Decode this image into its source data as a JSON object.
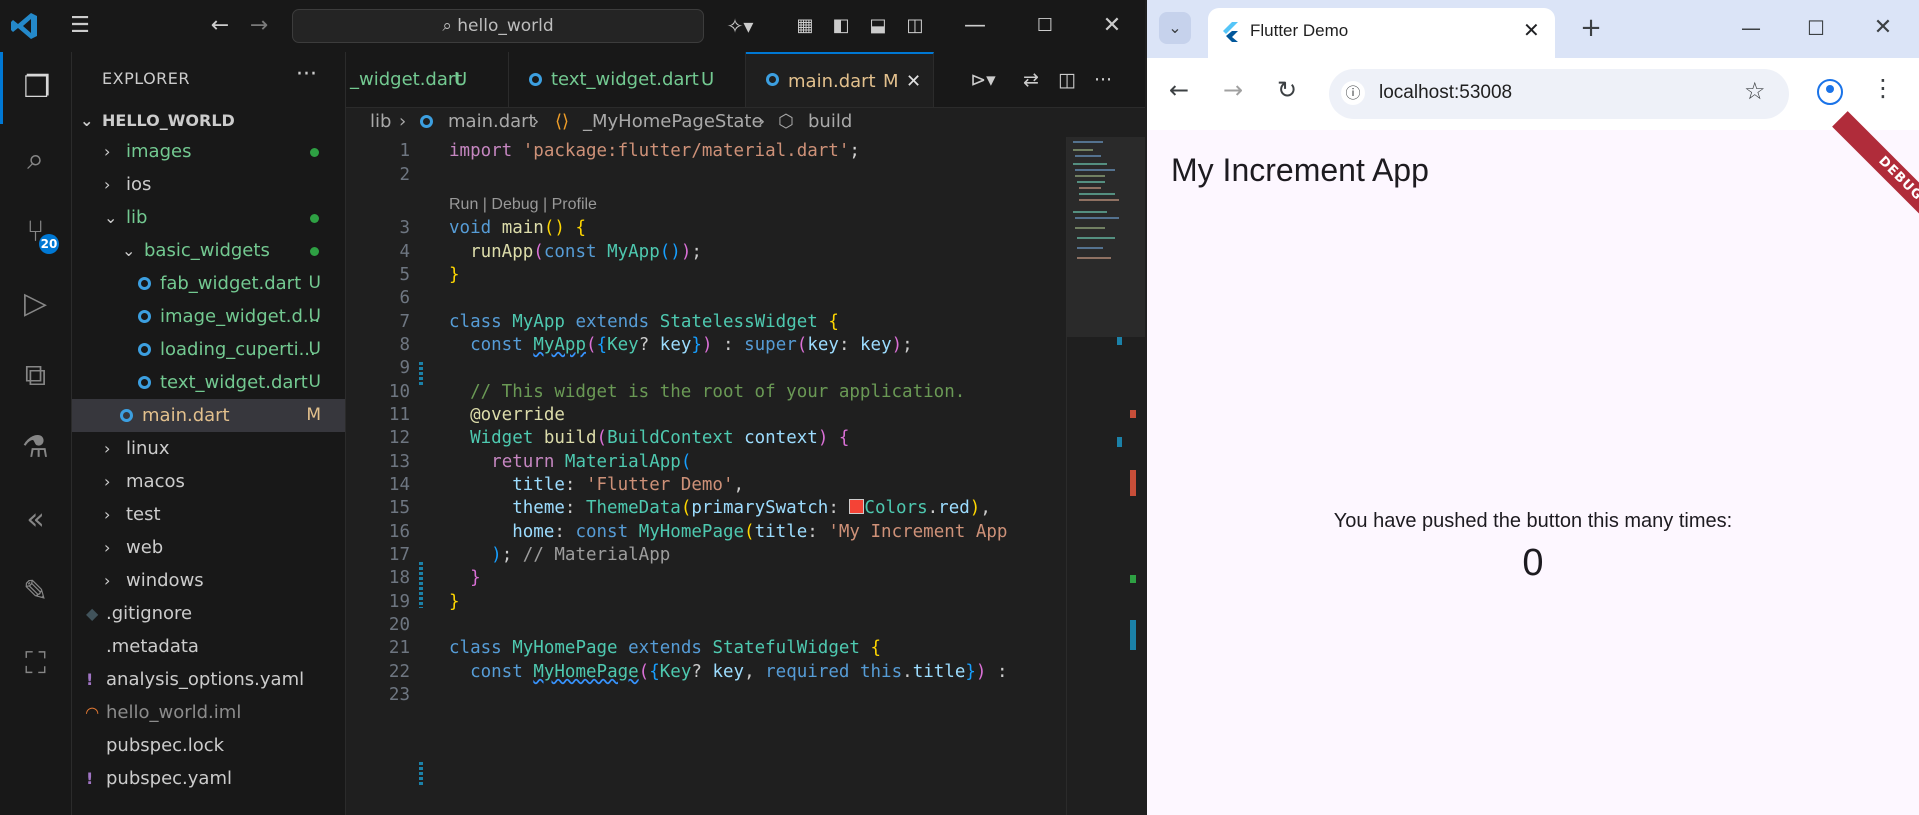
{
  "vscode": {
    "search_text": "hello_world",
    "activity_badge": "20",
    "explorer_title": "EXPLORER",
    "project_name": "HELLO_WORLD",
    "tree": [
      {
        "label": "images",
        "color": "#73c991",
        "status": "dot",
        "indent": 1,
        "type": "folder"
      },
      {
        "label": "ios",
        "color": "#cccccc",
        "status": "",
        "indent": 1,
        "type": "folder"
      },
      {
        "label": "lib",
        "color": "#73c991",
        "status": "dot",
        "indent": 1,
        "type": "folder-open"
      },
      {
        "label": "basic_widgets",
        "color": "#73c991",
        "status": "dot",
        "indent": 2,
        "type": "folder-open"
      },
      {
        "label": "fab_widget.dart",
        "color": "#73c991",
        "status": "U",
        "indent": 3,
        "type": "dart"
      },
      {
        "label": "image_widget.d...",
        "color": "#73c991",
        "status": "U",
        "indent": 3,
        "type": "dart"
      },
      {
        "label": "loading_cuperti...",
        "color": "#73c991",
        "status": "U",
        "indent": 3,
        "type": "dart"
      },
      {
        "label": "text_widget.dart",
        "color": "#73c991",
        "status": "U",
        "indent": 3,
        "type": "dart"
      },
      {
        "label": "main.dart",
        "color": "#e2c08d",
        "status": "M",
        "indent": 2,
        "type": "dart",
        "selected": true
      },
      {
        "label": "linux",
        "color": "#cccccc",
        "status": "",
        "indent": 1,
        "type": "folder"
      },
      {
        "label": "macos",
        "color": "#cccccc",
        "status": "",
        "indent": 1,
        "type": "folder"
      },
      {
        "label": "test",
        "color": "#cccccc",
        "status": "",
        "indent": 1,
        "type": "folder"
      },
      {
        "label": "web",
        "color": "#cccccc",
        "status": "",
        "indent": 1,
        "type": "folder"
      },
      {
        "label": "windows",
        "color": "#cccccc",
        "status": "",
        "indent": 1,
        "type": "folder"
      },
      {
        "label": ".gitignore",
        "color": "#cccccc",
        "status": "",
        "indent": 0,
        "type": "git"
      },
      {
        "label": ".metadata",
        "color": "#cccccc",
        "status": "",
        "indent": 0,
        "type": "file"
      },
      {
        "label": "analysis_options.yaml",
        "color": "#cccccc",
        "status": "",
        "indent": 0,
        "type": "yaml"
      },
      {
        "label": "hello_world.iml",
        "color": "#8c8c8c",
        "status": "",
        "indent": 0,
        "type": "rss"
      },
      {
        "label": "pubspec.lock",
        "color": "#cccccc",
        "status": "",
        "indent": 0,
        "type": "file"
      },
      {
        "label": "pubspec.yaml",
        "color": "#cccccc",
        "status": "",
        "indent": 0,
        "type": "yaml"
      }
    ],
    "tabs": [
      {
        "label": "_widget.dart",
        "status": "U"
      },
      {
        "label": "text_widget.dart",
        "status": "U"
      },
      {
        "label": "main.dart",
        "status": "M"
      }
    ],
    "breadcrumb": [
      "lib",
      "main.dart",
      "_MyHomePageState",
      "build"
    ],
    "codelens": "Run | Debug | Profile",
    "line_numbers": [
      "1",
      "2",
      "3",
      "4",
      "5",
      "6",
      "7",
      "8",
      "9",
      "10",
      "11",
      "12",
      "13",
      "14",
      "15",
      "16",
      "17",
      "18",
      "19",
      "20",
      "21",
      "22",
      "23"
    ]
  },
  "chrome": {
    "tab_title": "Flutter Demo",
    "url": "localhost:53008",
    "debug_banner": "DEBUG",
    "app_title": "My Increment App",
    "counter_label": "You have pushed the button this many times:",
    "counter_value": "0"
  }
}
